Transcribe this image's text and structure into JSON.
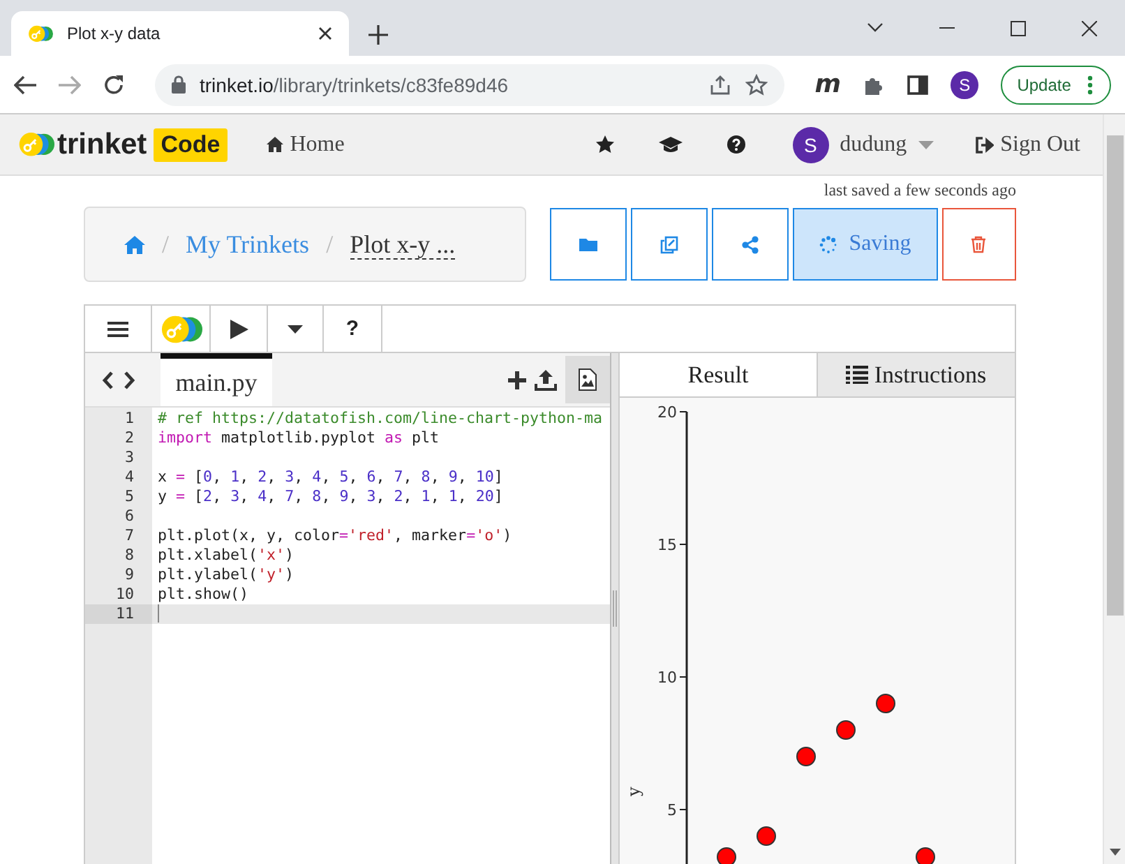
{
  "browser": {
    "tab_title": "Plot x-y data",
    "url_host": "trinket.io",
    "url_path": "/library/trinkets/c83fe89d46",
    "extension_letter": "m",
    "profile_initial": "S",
    "update_label": "Update"
  },
  "nav": {
    "logo_text": "trinket",
    "logo_badge": "Code",
    "home": "Home",
    "user_initial": "S",
    "username": "dudung",
    "sign_out": "Sign Out"
  },
  "save_status": "last saved a few seconds ago",
  "breadcrumb": {
    "separator": "/",
    "link": "My Trinkets",
    "title": "Plot x-y ..."
  },
  "actions": [
    {
      "kind": "folder"
    },
    {
      "kind": "copy"
    },
    {
      "kind": "share"
    },
    {
      "kind": "saving",
      "label": "Saving"
    },
    {
      "kind": "delete"
    }
  ],
  "toolbar": {
    "help": "?"
  },
  "editor": {
    "file_tab": "main.py",
    "lines": [
      {
        "number": "1",
        "current": false,
        "tokens": [
          {
            "kind": "comment",
            "text": "# ref https://datatofish.com/line-chart-python-ma"
          }
        ]
      },
      {
        "number": "2",
        "current": false,
        "tokens": [
          {
            "kind": "keyword",
            "text": "import"
          },
          {
            "kind": "plain",
            "text": " matplotlib.pyplot "
          },
          {
            "kind": "keyword",
            "text": "as"
          },
          {
            "kind": "plain",
            "text": " plt"
          }
        ]
      },
      {
        "number": "3",
        "current": false
      },
      {
        "number": "4",
        "current": false,
        "tokens": [
          {
            "kind": "plain",
            "text": "x "
          },
          {
            "kind": "op",
            "text": "="
          },
          {
            "kind": "plain",
            "text": " ["
          },
          {
            "kind": "number",
            "text": "0"
          },
          {
            "kind": "plain",
            "text": ", "
          },
          {
            "kind": "number",
            "text": "1"
          },
          {
            "kind": "plain",
            "text": ", "
          },
          {
            "kind": "number",
            "text": "2"
          },
          {
            "kind": "plain",
            "text": ", "
          },
          {
            "kind": "number",
            "text": "3"
          },
          {
            "kind": "plain",
            "text": ", "
          },
          {
            "kind": "number",
            "text": "4"
          },
          {
            "kind": "plain",
            "text": ", "
          },
          {
            "kind": "number",
            "text": "5"
          },
          {
            "kind": "plain",
            "text": ", "
          },
          {
            "kind": "number",
            "text": "6"
          },
          {
            "kind": "plain",
            "text": ", "
          },
          {
            "kind": "number",
            "text": "7"
          },
          {
            "kind": "plain",
            "text": ", "
          },
          {
            "kind": "number",
            "text": "8"
          },
          {
            "kind": "plain",
            "text": ", "
          },
          {
            "kind": "number",
            "text": "9"
          },
          {
            "kind": "plain",
            "text": ", "
          },
          {
            "kind": "number",
            "text": "10"
          },
          {
            "kind": "plain",
            "text": "]"
          }
        ]
      },
      {
        "number": "5",
        "current": false,
        "tokens": [
          {
            "kind": "plain",
            "text": "y "
          },
          {
            "kind": "op",
            "text": "="
          },
          {
            "kind": "plain",
            "text": " ["
          },
          {
            "kind": "number",
            "text": "2"
          },
          {
            "kind": "plain",
            "text": ", "
          },
          {
            "kind": "number",
            "text": "3"
          },
          {
            "kind": "plain",
            "text": ", "
          },
          {
            "kind": "number",
            "text": "4"
          },
          {
            "kind": "plain",
            "text": ", "
          },
          {
            "kind": "number",
            "text": "7"
          },
          {
            "kind": "plain",
            "text": ", "
          },
          {
            "kind": "number",
            "text": "8"
          },
          {
            "kind": "plain",
            "text": ", "
          },
          {
            "kind": "number",
            "text": "9"
          },
          {
            "kind": "plain",
            "text": ", "
          },
          {
            "kind": "number",
            "text": "3"
          },
          {
            "kind": "plain",
            "text": ", "
          },
          {
            "kind": "number",
            "text": "2"
          },
          {
            "kind": "plain",
            "text": ", "
          },
          {
            "kind": "number",
            "text": "1"
          },
          {
            "kind": "plain",
            "text": ", "
          },
          {
            "kind": "number",
            "text": "1"
          },
          {
            "kind": "plain",
            "text": ", "
          },
          {
            "kind": "number",
            "text": "20"
          },
          {
            "kind": "plain",
            "text": "]"
          }
        ]
      },
      {
        "number": "6",
        "current": false
      },
      {
        "number": "7",
        "current": false,
        "tokens": [
          {
            "kind": "plain",
            "text": "plt.plot(x, y, color"
          },
          {
            "kind": "op",
            "text": "="
          },
          {
            "kind": "string",
            "text": "'red'"
          },
          {
            "kind": "plain",
            "text": ", marker"
          },
          {
            "kind": "op",
            "text": "="
          },
          {
            "kind": "string",
            "text": "'o'"
          },
          {
            "kind": "plain",
            "text": ")"
          }
        ]
      },
      {
        "number": "8",
        "current": false,
        "tokens": [
          {
            "kind": "plain",
            "text": "plt.xlabel("
          },
          {
            "kind": "string",
            "text": "'x'"
          },
          {
            "kind": "plain",
            "text": ")"
          }
        ]
      },
      {
        "number": "9",
        "current": false,
        "tokens": [
          {
            "kind": "plain",
            "text": "plt.ylabel("
          },
          {
            "kind": "string",
            "text": "'y'"
          },
          {
            "kind": "plain",
            "text": ")"
          }
        ]
      },
      {
        "number": "10",
        "current": false,
        "tokens": [
          {
            "kind": "plain",
            "text": "plt.show()"
          }
        ]
      },
      {
        "number": "11",
        "current": true
      }
    ]
  },
  "result": {
    "tabs": [
      {
        "label": "Result",
        "selected": true
      },
      {
        "label": "Instructions",
        "selected": false
      }
    ],
    "plot": {
      "y_axis_label": "y",
      "y_tick_labels": [
        "20",
        "15",
        "10",
        "5"
      ]
    }
  }
}
